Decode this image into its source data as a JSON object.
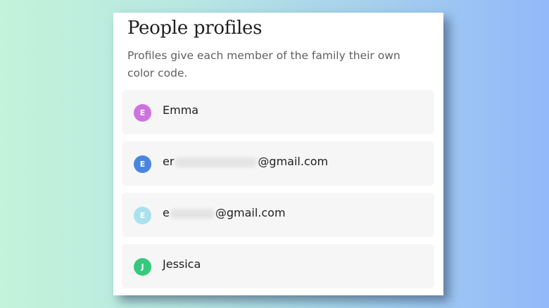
{
  "panel": {
    "title": "People profiles",
    "subtitle": "Profiles give each member of the family their own color code."
  },
  "profiles": [
    {
      "initial": "E",
      "prefix": "Emma",
      "suffix": "",
      "redacted": false,
      "color": "#cc74dd"
    },
    {
      "initial": "E",
      "prefix": "er",
      "suffix": "@gmail.com",
      "redacted": true,
      "color": "#4a86e0"
    },
    {
      "initial": "E",
      "prefix": "e",
      "suffix": "@gmail.com",
      "redacted": true,
      "color": "#a9e2ee"
    },
    {
      "initial": "J",
      "prefix": "Jessica",
      "suffix": "",
      "redacted": false,
      "color": "#35c97d"
    }
  ]
}
